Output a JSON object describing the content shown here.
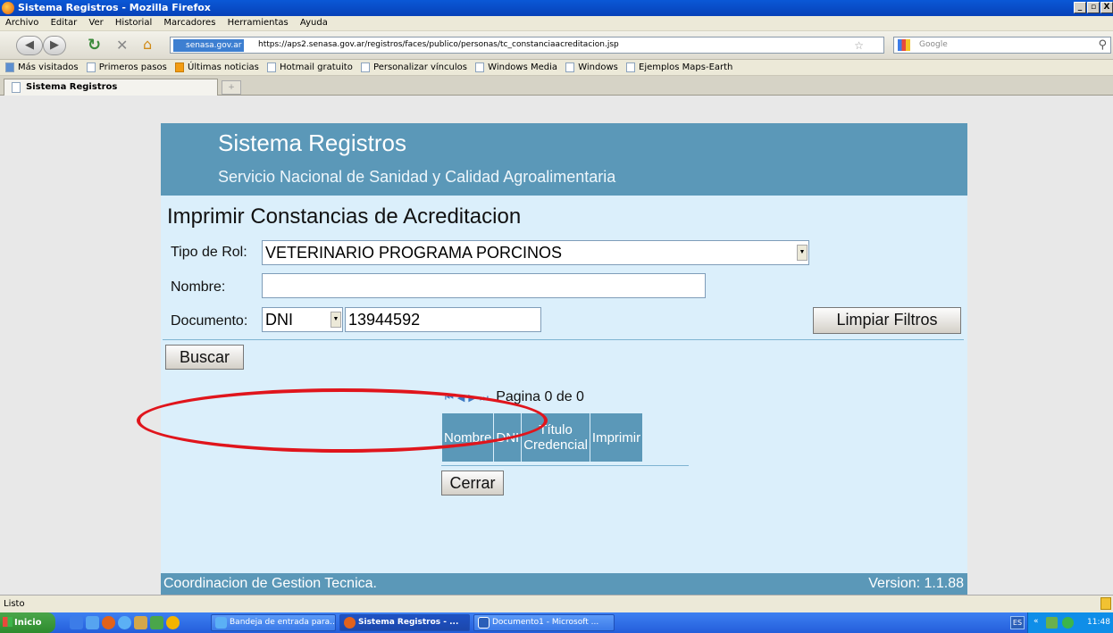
{
  "window": {
    "title": "Sistema Registros - Mozilla Firefox",
    "controls": [
      "_",
      "▫",
      "X"
    ]
  },
  "menubar": [
    "Archivo",
    "Editar",
    "Ver",
    "Historial",
    "Marcadores",
    "Herramientas",
    "Ayuda"
  ],
  "navbar": {
    "site_identity": "senasa.gov.ar",
    "url": "https://aps2.senasa.gov.ar/registros/faces/publico/personas/tc_constanciaacreditacion.jsp",
    "search_placeholder": "Google"
  },
  "bookmarks": [
    "Más visitados",
    "Primeros pasos",
    "Últimas noticias",
    "Hotmail gratuito",
    "Personalizar vínculos",
    "Windows Media",
    "Windows",
    "Ejemplos Maps-Earth"
  ],
  "tab": {
    "label": "Sistema Registros"
  },
  "header": {
    "title": "Sistema Registros",
    "subtitle": "Servicio Nacional de Sanidad y Calidad Agroalimentaria"
  },
  "form": {
    "page_title": "Imprimir Constancias de Acreditacion",
    "tipo_rol_label": "Tipo de Rol:",
    "tipo_rol_value": "VETERINARIO PROGRAMA PORCINOS",
    "nombre_label": "Nombre:",
    "nombre_value": "",
    "documento_label": "Documento:",
    "documento_type": "DNI",
    "documento_value": "13944592",
    "clear_button": "Limpiar Filtros",
    "search_button": "Buscar"
  },
  "results": {
    "pager_text": "Pagina 0 de 0",
    "columns": [
      "Nombre",
      "DNI",
      "Título Credencial",
      "Imprimir"
    ],
    "close_button": "Cerrar"
  },
  "footer": {
    "left": "Coordinacion de Gestion Tecnica.",
    "right": "Version: 1.1.88"
  },
  "statusbar": {
    "text": "Listo"
  },
  "taskbar": {
    "start": "Inicio",
    "tasks": [
      "Bandeja de entrada para...",
      "Sistema Registros - ...",
      "Documento1 - Microsoft ..."
    ],
    "lang": "ES",
    "clock": "11:48"
  },
  "colors": {
    "header_bg": "#5b98b8",
    "page_bg": "#dbeffb",
    "annotation_ellipse": "#e0151c"
  }
}
